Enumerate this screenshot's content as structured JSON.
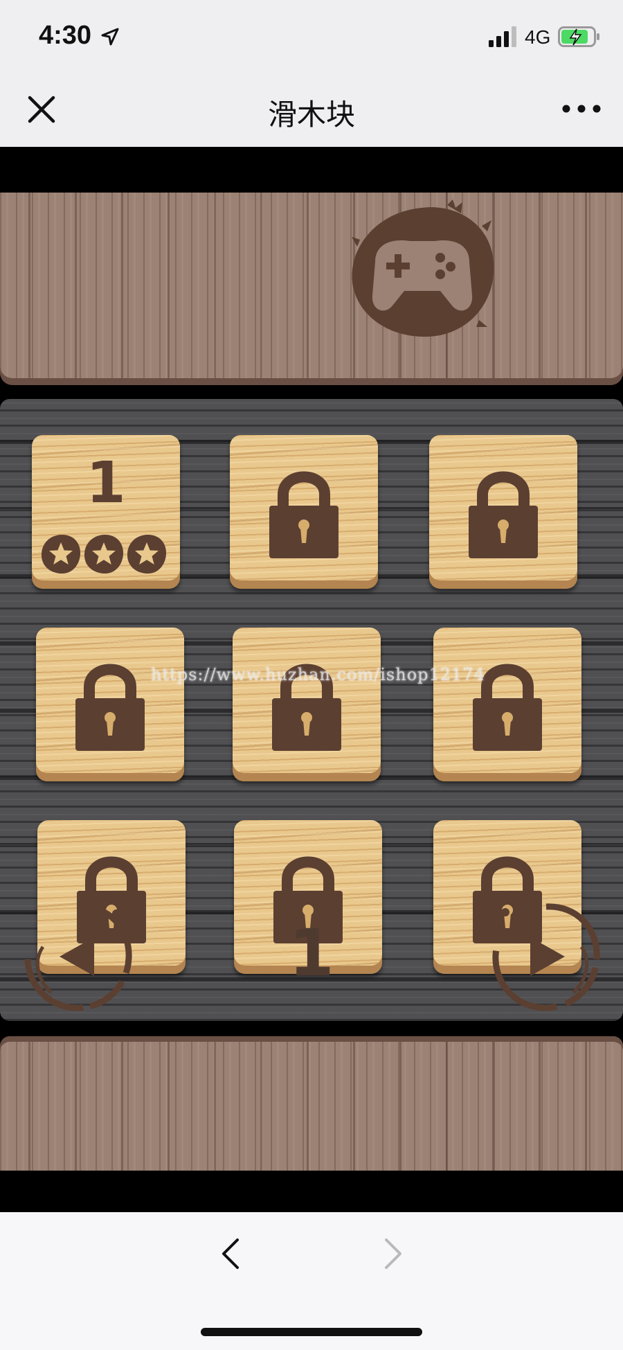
{
  "status_bar": {
    "time": "4:30",
    "network": "4G",
    "icons": [
      "location-arrow-icon",
      "signal-icon",
      "battery-charging-icon"
    ],
    "battery_color": "#4cd964"
  },
  "nav": {
    "title": "滑木块",
    "icons": [
      "close-icon",
      "more-icon"
    ]
  },
  "game": {
    "logo_icon": "gamepad-logo",
    "levels": [
      {
        "number": "1",
        "locked": false,
        "stars": 3
      },
      {
        "number": "",
        "locked": true
      },
      {
        "number": "",
        "locked": true
      },
      {
        "number": "",
        "locked": true
      },
      {
        "number": "",
        "locked": true
      },
      {
        "number": "",
        "locked": true
      },
      {
        "number": "",
        "locked": true
      },
      {
        "number": "",
        "locked": true
      },
      {
        "number": "",
        "locked": true
      }
    ],
    "page_number": "1",
    "nav_icons": [
      "arrow-left-icon",
      "arrow-right-icon"
    ],
    "colors": {
      "wood_dark": "#5b3f31",
      "tile_wood": "#e9c88d",
      "board_gray": "#505052",
      "plank_brown": "#9b8274"
    }
  },
  "watermark": "https://www.huzhan.com/ishop12174",
  "toolbar": {
    "icons": [
      "back-arrow-icon",
      "forward-arrow-icon"
    ]
  }
}
